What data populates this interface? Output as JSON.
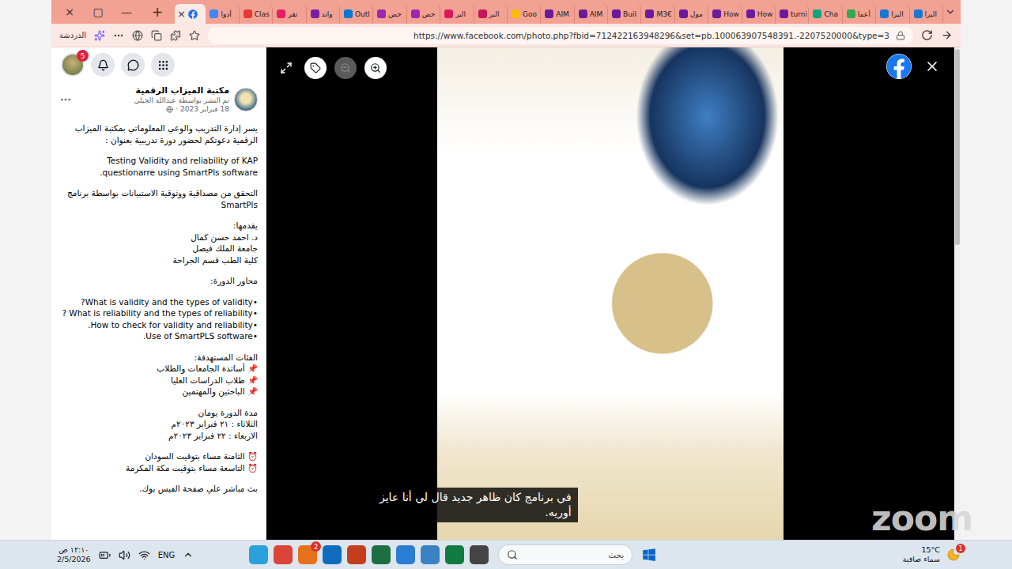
{
  "window_controls": [
    "×",
    "▢",
    "—"
  ],
  "new_tab": "+",
  "tabs": [
    {
      "kind": "icon",
      "close": "×",
      "selected": true,
      "color": "#1877f2"
    },
    {
      "kind": "text",
      "label": "أدوا",
      "selected": false,
      "color": "#4285f4"
    },
    {
      "kind": "text",
      "label": "Clas",
      "selected": false,
      "color": "#e53935"
    },
    {
      "kind": "text",
      "label": "تقر",
      "selected": false,
      "color": "#e91e63"
    },
    {
      "kind": "text",
      "label": "واتد",
      "selected": false,
      "color": "#7b1fa2"
    },
    {
      "kind": "text",
      "label": "Outl",
      "selected": false,
      "color": "#0078d4"
    },
    {
      "kind": "text",
      "label": "حض",
      "selected": false,
      "color": "#9c27b0"
    },
    {
      "kind": "text",
      "label": "حض",
      "selected": false,
      "color": "#9c27b0"
    },
    {
      "kind": "text",
      "label": "البر",
      "selected": false,
      "color": "#d81b60"
    },
    {
      "kind": "text",
      "label": "البر",
      "selected": false,
      "color": "#c2185b"
    },
    {
      "kind": "text",
      "label": "Goo",
      "selected": false,
      "color": "#fbbc05"
    },
    {
      "kind": "text",
      "label": "AIM",
      "selected": false,
      "color": "#6a1b9a"
    },
    {
      "kind": "text",
      "label": "AIM",
      "selected": false,
      "color": "#6a1b9a"
    },
    {
      "kind": "text",
      "label": "Buil",
      "selected": false,
      "color": "#6a1b9a"
    },
    {
      "kind": "text",
      "label": "M3€",
      "selected": false,
      "color": "#6a1b9a"
    },
    {
      "kind": "text",
      "label": "مول",
      "selected": false,
      "color": "#6a1b9a"
    },
    {
      "kind": "text",
      "label": "How",
      "selected": false,
      "color": "#6a1b9a"
    },
    {
      "kind": "text",
      "label": "How",
      "selected": false,
      "color": "#6a1b9a"
    },
    {
      "kind": "text",
      "label": "turni",
      "selected": false,
      "color": "#6a1b9a"
    },
    {
      "kind": "text",
      "label": "Cha",
      "selected": false,
      "color": "#10a37f"
    },
    {
      "kind": "text",
      "label": "أعما",
      "selected": false,
      "color": "#34a853"
    },
    {
      "kind": "text",
      "label": "البرا",
      "selected": false,
      "color": "#1976d2"
    },
    {
      "kind": "text",
      "label": "البرا",
      "selected": false,
      "color": "#1976d2"
    }
  ],
  "address_bar": {
    "chat_label": "الدردشة",
    "url": "https://www.facebook.com/photo.php?fbid=712422163948296&set=pb.100063907548391.-2207520000&type=3"
  },
  "facebook": {
    "notifications": "5"
  },
  "post": {
    "page": "مكتبة الميزاب الرقمية",
    "posted_by": "تم النشر بواسطة عبدالله الجيلي",
    "date": "18 فبراير 2023 ·",
    "body": [
      [
        "يسر إدارة التدريب والوعي المعلوماتي بمكتبة الميزاب الرقمية دعوتكم لحضور دورة تدريبية بعنوان :"
      ],
      [
        "Testing Validity and reliability of KAP questionarre using SmartPls software."
      ],
      [
        "التحقق من مصداقية ووثوقية الاستبيانات بواسطة برنامج SmartPls"
      ],
      [
        "يقدمها:",
        "د. احمد حسن كمال",
        "جامعة الملك فيصل",
        "كلية الطب قسم الجراحة"
      ],
      [
        "محاور الدورة:"
      ],
      [
        "•What is validity and the types of validity?",
        "•What is reliability and the types of reliability ?",
        "•How to check for validity and reliability.",
        "•Use of SmartPLS software."
      ],
      [
        "الفئات المستهدفة:",
        "📌 أساتذة الجامعات والطلاب",
        "📌 طلاب الدراسات العليا",
        "📌 الباحثين والمهتمين"
      ],
      [
        "مدة الدورة يومان",
        "الثلاثاء : ٢١ فبراير ٢٠٢٣م",
        "الاربعاء : ٢٢ فبراير ٢٠٢٣م"
      ],
      [
        "⏰ الثامنة مساء بتوقيت السودان",
        "⏰ التاسعة مساء بتوقيت مكة المكرمة"
      ],
      [
        "بث مباشر علي صفحة الفيس بوك."
      ]
    ]
  },
  "viewer": {
    "zoom_out_disabled": true
  },
  "caption": [
    "في برنامج كان ظاهر جديد قال لي أنا عايز",
    "أوريه."
  ],
  "watermark": "zoom",
  "taskbar": {
    "time": "١٢:١٠ ص",
    "date": "2/5/2026",
    "language": "ENG",
    "search_placeholder": "بحث",
    "apps": [
      {
        "color": "#2aa1da",
        "badge": ""
      },
      {
        "color": "#db4437",
        "badge": ""
      },
      {
        "color": "#e8711c",
        "badge": "2"
      },
      {
        "color": "#0f6cbd",
        "badge": ""
      },
      {
        "color": "#c43e1c",
        "badge": ""
      },
      {
        "color": "#1d6f42",
        "badge": ""
      },
      {
        "color": "#2b7cd3",
        "badge": ""
      },
      {
        "color": "#3b82c4",
        "badge": ""
      },
      {
        "color": "#107c41",
        "badge": ""
      },
      {
        "color": "#444444",
        "badge": ""
      }
    ],
    "weather": {
      "temp": "15°C",
      "desc": "سماء صافية",
      "badge": "1"
    }
  }
}
